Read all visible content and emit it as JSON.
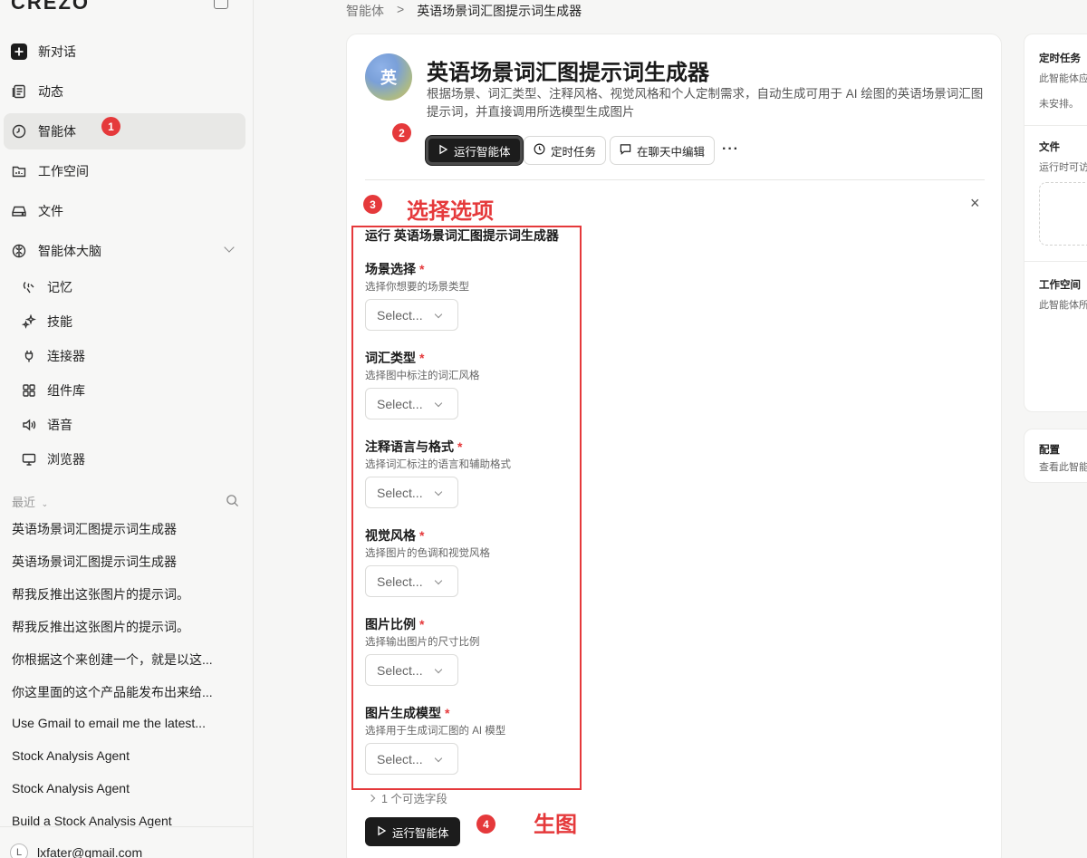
{
  "sidebar": {
    "logo": "CREZO",
    "nav": [
      {
        "label": "新对话",
        "icon": "plus-icon"
      },
      {
        "label": "动态",
        "icon": "feed-icon"
      },
      {
        "label": "智能体",
        "icon": "agent-icon"
      },
      {
        "label": "工作空间",
        "icon": "workspace-icon"
      },
      {
        "label": "文件",
        "icon": "drive-icon"
      },
      {
        "label": "智能体大脑",
        "icon": "brain-icon"
      }
    ],
    "sub": [
      {
        "label": "记忆",
        "icon": "memory-icon"
      },
      {
        "label": "技能",
        "icon": "skills-icon"
      },
      {
        "label": "连接器",
        "icon": "plug-icon"
      },
      {
        "label": "组件库",
        "icon": "components-icon"
      },
      {
        "label": "语音",
        "icon": "speaker-icon"
      },
      {
        "label": "浏览器",
        "icon": "monitor-icon"
      }
    ],
    "recent_label": "最近",
    "recent": [
      "英语场景词汇图提示词生成器",
      "英语场景词汇图提示词生成器",
      "帮我反推出这张图片的提示词。",
      "帮我反推出这张图片的提示词。",
      "你根据这个来创建一个，就是以这...",
      "你这里面的这个产品能发布出来给...",
      "Use Gmail to email me the latest...",
      "Stock Analysis Agent",
      "Stock Analysis Agent",
      "Build a Stock Analysis Agent"
    ],
    "user": {
      "initial": "L",
      "email": "lxfater@gmail.com"
    }
  },
  "breadcrumb": {
    "parent": "智能体",
    "sep": ">",
    "current": "英语场景词汇图提示词生成器"
  },
  "agent": {
    "avatar_text": "英",
    "title": "英语场景词汇图提示词生成器",
    "description": "根据场景、词汇类型、注释风格、视觉风格和个人定制需求，自动生成可用于 AI 绘图的英语场景词汇图提示词，并直接调用所选模型生成图片"
  },
  "toolbar": {
    "run_label": "运行智能体",
    "schedule_label": "定时任务",
    "edit_label": "在聊天中编辑",
    "more_label": "···"
  },
  "form": {
    "title": "运行 英语场景词汇图提示词生成器",
    "required_mark": "*",
    "fields": [
      {
        "label": "场景选择",
        "help": "选择你想要的场景类型",
        "placeholder": "Select..."
      },
      {
        "label": "词汇类型",
        "help": "选择图中标注的词汇风格",
        "placeholder": "Select..."
      },
      {
        "label": "注释语言与格式",
        "help": "选择词汇标注的语言和辅助格式",
        "placeholder": "Select..."
      },
      {
        "label": "视觉风格",
        "help": "选择图片的色调和视觉风格",
        "placeholder": "Select..."
      },
      {
        "label": "图片比例",
        "help": "选择输出图片的尺寸比例",
        "placeholder": "Select..."
      },
      {
        "label": "图片生成模型",
        "help": "选择用于生成词汇图的 AI 模型",
        "placeholder": "Select..."
      }
    ],
    "optional_label": "1 个可选字段",
    "run_label": "运行智能体",
    "close": "×"
  },
  "annotations": {
    "badges": [
      "1",
      "2",
      "3",
      "4"
    ],
    "select_options": "选择选项",
    "generate": "生图",
    "color": "#e5393b"
  },
  "right_panel": {
    "scheduled_title": "定时任务",
    "scheduled_desc": "此智能体应",
    "scheduled_status": "未安排。",
    "files_title": "文件",
    "files_desc": "运行时可访",
    "workspace_title": "工作空间",
    "workspace_desc": "此智能体所",
    "config_title": "配置",
    "config_desc": "查看此智能"
  }
}
